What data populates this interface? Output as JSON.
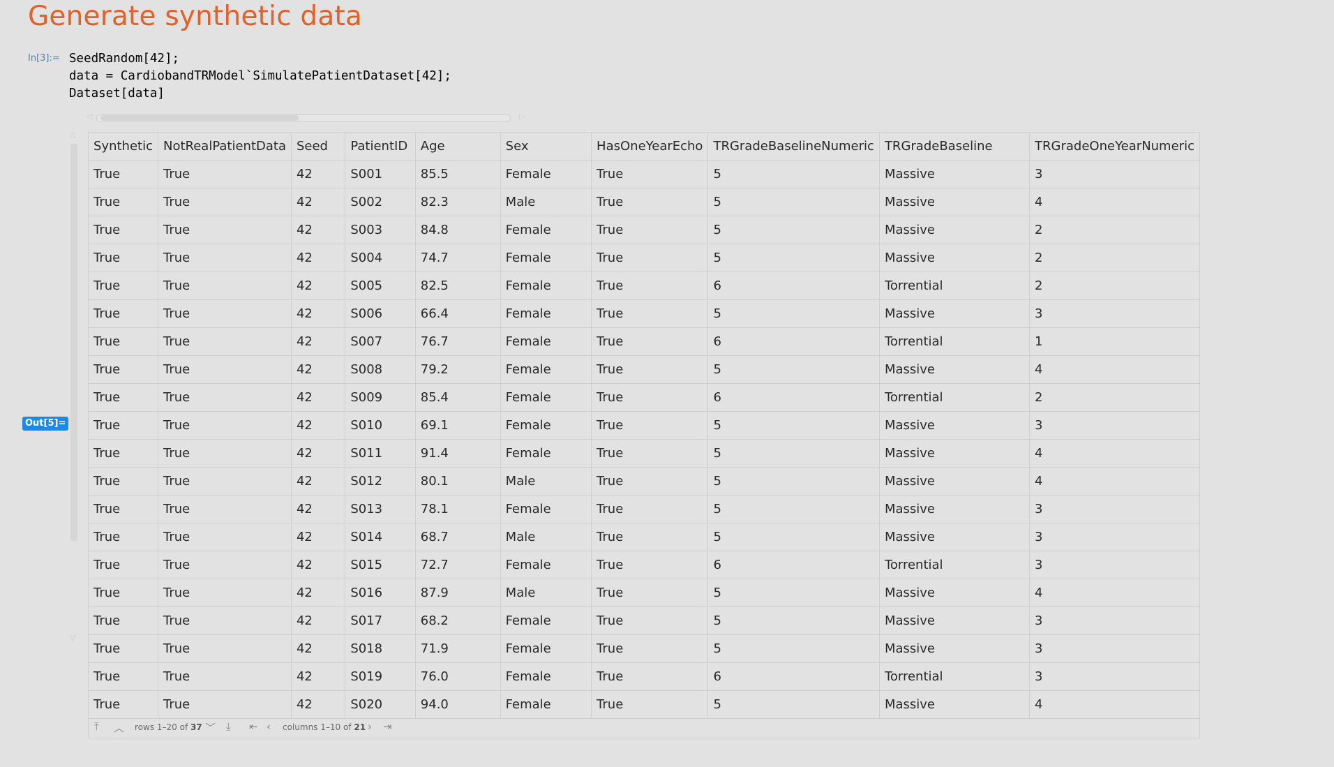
{
  "section_title": "Generate synthetic data",
  "input_cell": {
    "label": "In[3]:=",
    "code_lines": [
      "SeedRandom[42];",
      "data = CardiobandTRModel`SimulatePatientDataset[42];",
      "Dataset[data]"
    ]
  },
  "output_cell": {
    "label": "Out[5]="
  },
  "table": {
    "columns": [
      "Synthetic",
      "NotRealPatientData",
      "Seed",
      "PatientID",
      "Age",
      "Sex",
      "HasOneYearEcho",
      "TRGradeBaselineNumeric",
      "TRGradeBaseline",
      "TRGradeOneYearNumeric"
    ],
    "rows": [
      [
        "True",
        "True",
        "42",
        "S001",
        "85.5",
        "Female",
        "True",
        "5",
        "Massive",
        "3"
      ],
      [
        "True",
        "True",
        "42",
        "S002",
        "82.3",
        "Male",
        "True",
        "5",
        "Massive",
        "4"
      ],
      [
        "True",
        "True",
        "42",
        "S003",
        "84.8",
        "Female",
        "True",
        "5",
        "Massive",
        "2"
      ],
      [
        "True",
        "True",
        "42",
        "S004",
        "74.7",
        "Female",
        "True",
        "5",
        "Massive",
        "2"
      ],
      [
        "True",
        "True",
        "42",
        "S005",
        "82.5",
        "Female",
        "True",
        "6",
        "Torrential",
        "2"
      ],
      [
        "True",
        "True",
        "42",
        "S006",
        "66.4",
        "Female",
        "True",
        "5",
        "Massive",
        "3"
      ],
      [
        "True",
        "True",
        "42",
        "S007",
        "76.7",
        "Female",
        "True",
        "6",
        "Torrential",
        "1"
      ],
      [
        "True",
        "True",
        "42",
        "S008",
        "79.2",
        "Female",
        "True",
        "5",
        "Massive",
        "4"
      ],
      [
        "True",
        "True",
        "42",
        "S009",
        "85.4",
        "Female",
        "True",
        "6",
        "Torrential",
        "2"
      ],
      [
        "True",
        "True",
        "42",
        "S010",
        "69.1",
        "Female",
        "True",
        "5",
        "Massive",
        "3"
      ],
      [
        "True",
        "True",
        "42",
        "S011",
        "91.4",
        "Female",
        "True",
        "5",
        "Massive",
        "4"
      ],
      [
        "True",
        "True",
        "42",
        "S012",
        "80.1",
        "Male",
        "True",
        "5",
        "Massive",
        "4"
      ],
      [
        "True",
        "True",
        "42",
        "S013",
        "78.1",
        "Female",
        "True",
        "5",
        "Massive",
        "3"
      ],
      [
        "True",
        "True",
        "42",
        "S014",
        "68.7",
        "Male",
        "True",
        "5",
        "Massive",
        "3"
      ],
      [
        "True",
        "True",
        "42",
        "S015",
        "72.7",
        "Female",
        "True",
        "6",
        "Torrential",
        "3"
      ],
      [
        "True",
        "True",
        "42",
        "S016",
        "87.9",
        "Male",
        "True",
        "5",
        "Massive",
        "4"
      ],
      [
        "True",
        "True",
        "42",
        "S017",
        "68.2",
        "Female",
        "True",
        "5",
        "Massive",
        "3"
      ],
      [
        "True",
        "True",
        "42",
        "S018",
        "71.9",
        "Female",
        "True",
        "5",
        "Massive",
        "3"
      ],
      [
        "True",
        "True",
        "42",
        "S019",
        "76.0",
        "Female",
        "True",
        "6",
        "Torrential",
        "3"
      ],
      [
        "True",
        "True",
        "42",
        "S020",
        "94.0",
        "Female",
        "True",
        "5",
        "Massive",
        "4"
      ]
    ]
  },
  "pagination": {
    "rows_prefix": "rows 1–20 of",
    "rows_total": "37",
    "cols_prefix": "columns 1–10 of",
    "cols_total": "21"
  }
}
